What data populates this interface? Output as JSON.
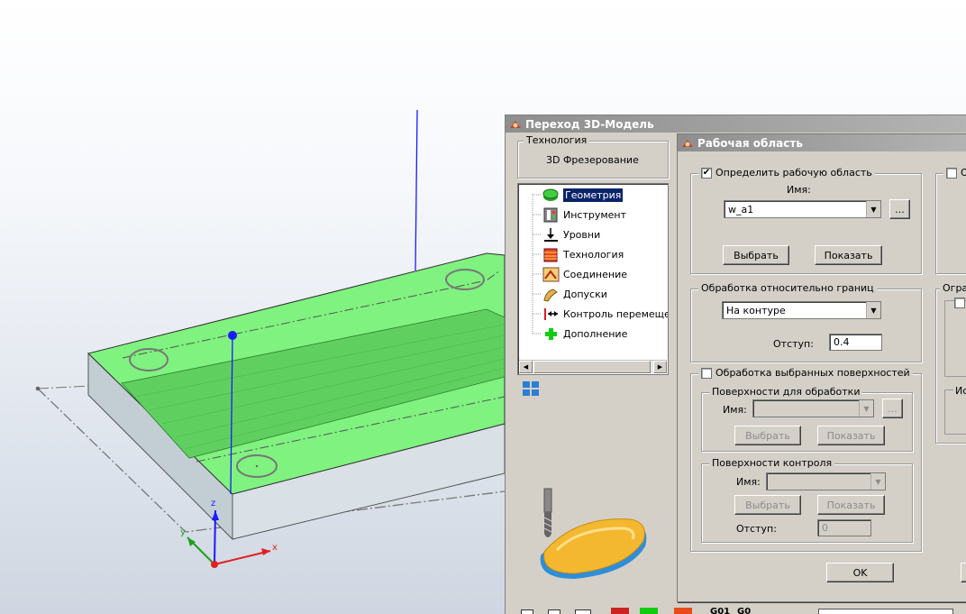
{
  "colors": {
    "part_green": "#7ef07e",
    "part_side": "#c7d3d9",
    "axis_x": "#e02020",
    "axis_y": "#1fa01f",
    "axis_z": "#1a1aff",
    "dialog_bg": "#d4d0c8"
  },
  "viewport": {
    "axis": {
      "x": "x",
      "y": "y",
      "z": "z"
    }
  },
  "main_dialog": {
    "title": "Переход 3D-Модель",
    "technology_group": "Технология",
    "technology_value": "3D Фрезерование",
    "tree": [
      {
        "label": "Геометрия",
        "icon": "geometry-icon",
        "selected": true
      },
      {
        "label": "Инструмент",
        "icon": "tool-icon"
      },
      {
        "label": "Уровни",
        "icon": "levels-icon"
      },
      {
        "label": "Технология",
        "icon": "technology-icon"
      },
      {
        "label": "Соединение",
        "icon": "connection-icon"
      },
      {
        "label": "Допуски",
        "icon": "tolerances-icon"
      },
      {
        "label": "Контроль перемещений",
        "icon": "motion-control-icon"
      },
      {
        "label": "Дополнение",
        "icon": "addition-icon"
      }
    ],
    "toolbar": {
      "g01": "G01",
      "g0": "G0"
    }
  },
  "work_area_dialog": {
    "title": "Рабочая область",
    "define_area": {
      "label": "Определить рабочую область",
      "checked": true,
      "name_label": "Имя:",
      "name_value": "w_a1",
      "ellipsis": "...",
      "select": "Выбрать",
      "show": "Показать"
    },
    "boundary": {
      "title": "Обработка относительно границ",
      "mode": "На контуре",
      "offset_label": "Отступ:",
      "offset_value": "0.4"
    },
    "surfaces": {
      "label": "Обработка выбранных поверхностей",
      "checked": false,
      "process_group": "Поверхности для обработки",
      "process_name_label": "Имя:",
      "ellipsis": "...",
      "select": "Выбрать",
      "show": "Показать",
      "control_group": "Поверхности контроля",
      "control_name_label": "Имя:",
      "control_select": "Выбрать",
      "control_show": "Показать",
      "control_offset_label": "Отступ:",
      "control_offset_value": "0"
    },
    "ok": "OK",
    "right_partial": {
      "chk_label": "О",
      "group_label": "Огра",
      "group2_label": "Ис"
    }
  }
}
